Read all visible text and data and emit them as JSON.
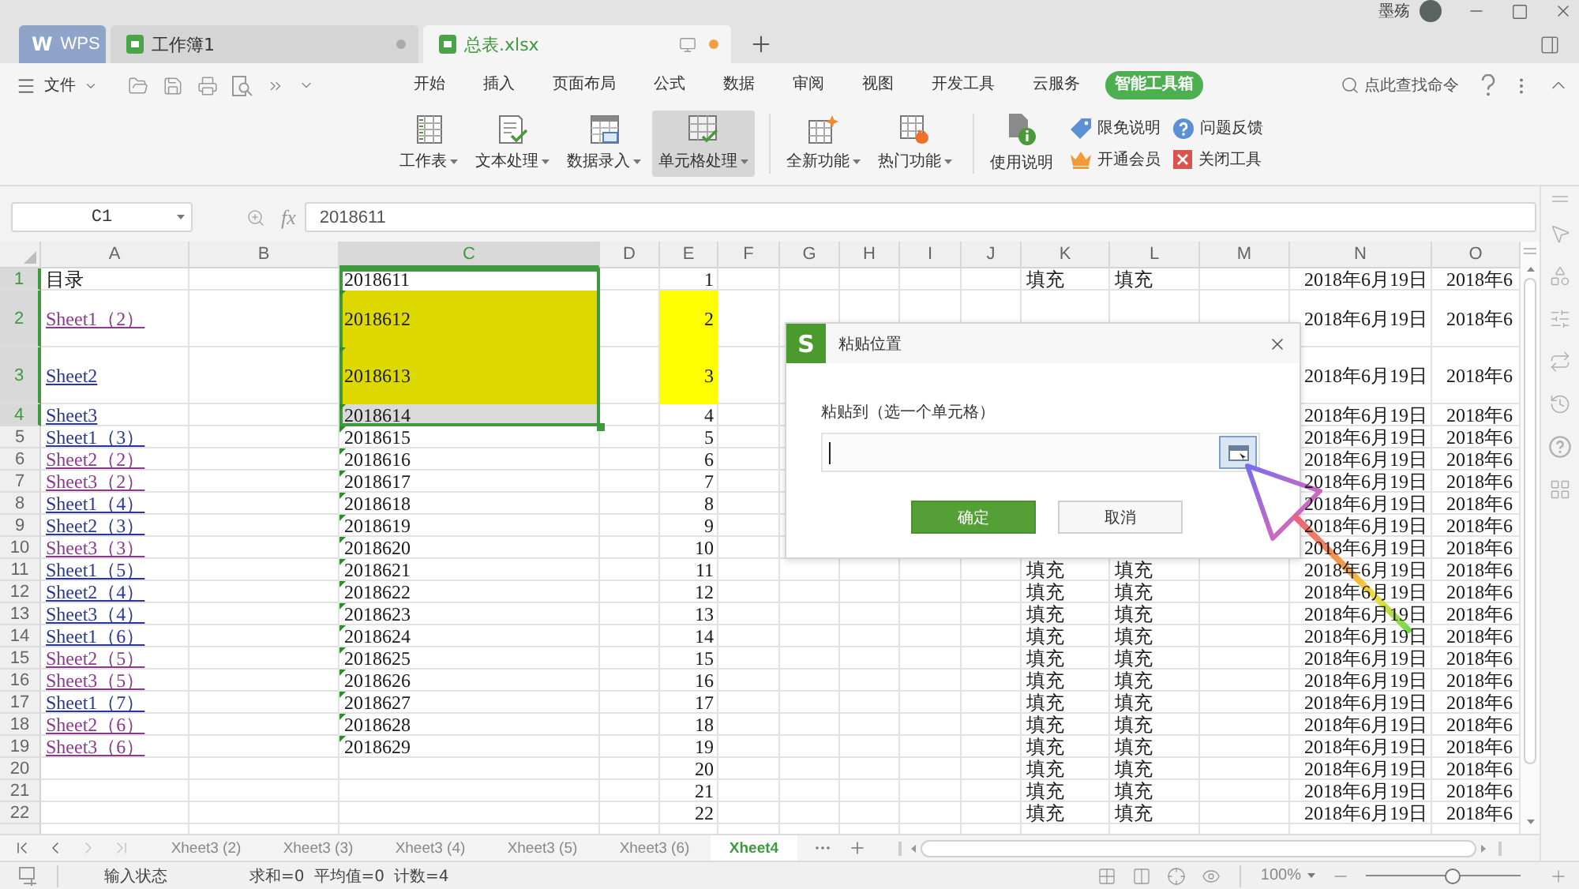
{
  "window": {
    "user_name": "墨殇"
  },
  "app_tabs": [
    {
      "kind": "home",
      "logo": "W",
      "label": "WPS",
      "selected": false
    },
    {
      "kind": "document",
      "label": "工作簿1",
      "selected": false,
      "modified": false
    },
    {
      "kind": "document",
      "label": "总表.xlsx",
      "selected": true,
      "modified": true
    }
  ],
  "menu": {
    "file_label": "文件"
  },
  "ribbon_tabs": [
    {
      "label": "开始",
      "selected": false
    },
    {
      "label": "插入",
      "selected": false
    },
    {
      "label": "页面布局",
      "selected": false
    },
    {
      "label": "公式",
      "selected": false
    },
    {
      "label": "数据",
      "selected": false
    },
    {
      "label": "审阅",
      "selected": false
    },
    {
      "label": "视图",
      "selected": false
    },
    {
      "label": "开发工具",
      "selected": false
    },
    {
      "label": "云服务",
      "selected": false
    },
    {
      "label": "智能工具箱",
      "selected": true
    }
  ],
  "command_search": {
    "placeholder": "点此查找命令"
  },
  "toolbar": [
    {
      "buttons": [
        {
          "label": "工作表",
          "dropdown": true,
          "selected": false
        },
        {
          "label": "文本处理",
          "dropdown": true,
          "selected": false
        },
        {
          "label": "数据录入",
          "dropdown": true,
          "selected": false
        },
        {
          "label": "单元格处理",
          "dropdown": true,
          "selected": true
        }
      ]
    },
    {
      "buttons": [
        {
          "label": "全新功能",
          "dropdown": true,
          "selected": false
        },
        {
          "label": "热门功能",
          "dropdown": true,
          "selected": false
        }
      ]
    },
    {
      "buttons": [
        {
          "label": "使用说明",
          "dropdown": false,
          "selected": false
        }
      ],
      "links": [
        {
          "label": "限免说明"
        },
        {
          "label": "问题反馈"
        },
        {
          "label": "开通会员"
        },
        {
          "label": "关闭工具"
        }
      ]
    }
  ],
  "formula_bar": {
    "cell_name": "C1",
    "function_label": "fx",
    "value": "2018611"
  },
  "sheet": {
    "columns": [
      {
        "label": "A",
        "selected": false
      },
      {
        "label": "B",
        "selected": false
      },
      {
        "label": "C",
        "selected": true
      },
      {
        "label": "D",
        "selected": false
      },
      {
        "label": "E",
        "selected": false
      },
      {
        "label": "F",
        "selected": false
      },
      {
        "label": "G",
        "selected": false
      },
      {
        "label": "H",
        "selected": false
      },
      {
        "label": "I",
        "selected": false
      },
      {
        "label": "J",
        "selected": false
      },
      {
        "label": "K",
        "selected": false
      },
      {
        "label": "L",
        "selected": false
      },
      {
        "label": "M",
        "selected": false
      },
      {
        "label": "N",
        "selected": false
      },
      {
        "label": "O",
        "selected": false
      }
    ],
    "rows": [
      {
        "number": "1",
        "selected": true,
        "tall": false,
        "cells": {
          "a": {
            "kind": "text",
            "text": "目录"
          },
          "c": {
            "text": "2018611",
            "flag": false,
            "highlighted": false
          },
          "e": {
            "text": "1",
            "highlighted": false
          },
          "k": {
            "text": "填充"
          },
          "l": {
            "text": "填充"
          },
          "n": {
            "text": "2018年6月19日"
          },
          "o": {
            "text": "2018年6"
          }
        }
      },
      {
        "number": "2",
        "selected": true,
        "tall": true,
        "cells": {
          "a": {
            "kind": "link",
            "text": "Sheet1（2）",
            "visited": true
          },
          "c": {
            "text": "2018612",
            "flag": true,
            "highlighted": true
          },
          "e": {
            "text": "2",
            "highlighted": true
          },
          "n": {
            "text": "2018年6月19日"
          },
          "o": {
            "text": "2018年6"
          }
        }
      },
      {
        "number": "3",
        "selected": true,
        "tall": true,
        "cells": {
          "a": {
            "kind": "link",
            "text": "Sheet2",
            "visited": false
          },
          "c": {
            "text": "2018613",
            "flag": true,
            "highlighted": true
          },
          "e": {
            "text": "3",
            "highlighted": true
          },
          "n": {
            "text": "2018年6月19日"
          },
          "o": {
            "text": "2018年6"
          }
        }
      },
      {
        "number": "4",
        "selected": true,
        "tall": false,
        "cells": {
          "a": {
            "kind": "link",
            "text": "Sheet3",
            "visited": false
          },
          "c": {
            "text": "2018614",
            "flag": true,
            "highlighted": false
          },
          "e": {
            "text": "4",
            "highlighted": false
          },
          "n": {
            "text": "2018年6月19日"
          },
          "o": {
            "text": "2018年6"
          }
        }
      },
      {
        "number": "5",
        "selected": false,
        "tall": false,
        "cells": {
          "a": {
            "kind": "link",
            "text": "Sheet1（3）",
            "visited": false
          },
          "c": {
            "text": "2018615",
            "flag": true,
            "highlighted": false
          },
          "e": {
            "text": "5",
            "highlighted": false
          },
          "n": {
            "text": "2018年6月19日"
          },
          "o": {
            "text": "2018年6"
          }
        }
      },
      {
        "number": "6",
        "selected": false,
        "tall": false,
        "cells": {
          "a": {
            "kind": "link",
            "text": "Sheet2（2）",
            "visited": true
          },
          "c": {
            "text": "2018616",
            "flag": true,
            "highlighted": false
          },
          "e": {
            "text": "6",
            "highlighted": false
          },
          "n": {
            "text": "2018年6月19日"
          },
          "o": {
            "text": "2018年6"
          }
        }
      },
      {
        "number": "7",
        "selected": false,
        "tall": false,
        "cells": {
          "a": {
            "kind": "link",
            "text": "Sheet3（2）",
            "visited": true
          },
          "c": {
            "text": "2018617",
            "flag": true,
            "highlighted": false
          },
          "e": {
            "text": "7",
            "highlighted": false
          },
          "n": {
            "text": "2018年6月19日"
          },
          "o": {
            "text": "2018年6"
          }
        }
      },
      {
        "number": "8",
        "selected": false,
        "tall": false,
        "cells": {
          "a": {
            "kind": "link",
            "text": "Sheet1（4）",
            "visited": false
          },
          "c": {
            "text": "2018618",
            "flag": true,
            "highlighted": false
          },
          "e": {
            "text": "8",
            "highlighted": false
          },
          "n": {
            "text": "2018年6月19日"
          },
          "o": {
            "text": "2018年6"
          }
        }
      },
      {
        "number": "9",
        "selected": false,
        "tall": false,
        "cells": {
          "a": {
            "kind": "link",
            "text": "Sheet2（3）",
            "visited": false
          },
          "c": {
            "text": "2018619",
            "flag": true,
            "highlighted": false
          },
          "e": {
            "text": "9",
            "highlighted": false
          },
          "n": {
            "text": "2018年6月19日"
          },
          "o": {
            "text": "2018年6"
          }
        }
      },
      {
        "number": "10",
        "selected": false,
        "tall": false,
        "cells": {
          "a": {
            "kind": "link",
            "text": "Sheet3（3）",
            "visited": true
          },
          "c": {
            "text": "2018620",
            "flag": true,
            "highlighted": false
          },
          "e": {
            "text": "10",
            "highlighted": false
          },
          "n": {
            "text": "2018年6月19日"
          },
          "o": {
            "text": "2018年6"
          }
        }
      },
      {
        "number": "11",
        "selected": false,
        "tall": false,
        "cells": {
          "a": {
            "kind": "link",
            "text": "Sheet1（5）",
            "visited": false
          },
          "c": {
            "text": "2018621",
            "flag": true,
            "highlighted": false
          },
          "e": {
            "text": "11",
            "highlighted": false
          },
          "k": {
            "text": "填充"
          },
          "l": {
            "text": "填充"
          },
          "n": {
            "text": "2018年6月19日"
          },
          "o": {
            "text": "2018年6"
          }
        }
      },
      {
        "number": "12",
        "selected": false,
        "tall": false,
        "cells": {
          "a": {
            "kind": "link",
            "text": "Sheet2（4）",
            "visited": false
          },
          "c": {
            "text": "2018622",
            "flag": true,
            "highlighted": false
          },
          "e": {
            "text": "12",
            "highlighted": false
          },
          "k": {
            "text": "填充"
          },
          "l": {
            "text": "填充"
          },
          "n": {
            "text": "2018年6月19日"
          },
          "o": {
            "text": "2018年6"
          }
        }
      },
      {
        "number": "13",
        "selected": false,
        "tall": false,
        "cells": {
          "a": {
            "kind": "link",
            "text": "Sheet3（4）",
            "visited": false
          },
          "c": {
            "text": "2018623",
            "flag": true,
            "highlighted": false
          },
          "e": {
            "text": "13",
            "highlighted": false
          },
          "k": {
            "text": "填充"
          },
          "l": {
            "text": "填充"
          },
          "n": {
            "text": "2018年6月19日"
          },
          "o": {
            "text": "2018年6"
          }
        }
      },
      {
        "number": "14",
        "selected": false,
        "tall": false,
        "cells": {
          "a": {
            "kind": "link",
            "text": "Sheet1（6）",
            "visited": false
          },
          "c": {
            "text": "2018624",
            "flag": true,
            "highlighted": false
          },
          "e": {
            "text": "14",
            "highlighted": false
          },
          "k": {
            "text": "填充"
          },
          "l": {
            "text": "填充"
          },
          "n": {
            "text": "2018年6月19日"
          },
          "o": {
            "text": "2018年6"
          }
        }
      },
      {
        "number": "15",
        "selected": false,
        "tall": false,
        "cells": {
          "a": {
            "kind": "link",
            "text": "Sheet2（5）",
            "visited": true
          },
          "c": {
            "text": "2018625",
            "flag": true,
            "highlighted": false
          },
          "e": {
            "text": "15",
            "highlighted": false
          },
          "k": {
            "text": "填充"
          },
          "l": {
            "text": "填充"
          },
          "n": {
            "text": "2018年6月19日"
          },
          "o": {
            "text": "2018年6"
          }
        }
      },
      {
        "number": "16",
        "selected": false,
        "tall": false,
        "cells": {
          "a": {
            "kind": "link",
            "text": "Sheet3（5）",
            "visited": true
          },
          "c": {
            "text": "2018626",
            "flag": true,
            "highlighted": false
          },
          "e": {
            "text": "16",
            "highlighted": false
          },
          "k": {
            "text": "填充"
          },
          "l": {
            "text": "填充"
          },
          "n": {
            "text": "2018年6月19日"
          },
          "o": {
            "text": "2018年6"
          }
        }
      },
      {
        "number": "17",
        "selected": false,
        "tall": false,
        "cells": {
          "a": {
            "kind": "link",
            "text": "Sheet1（7）",
            "visited": false
          },
          "c": {
            "text": "2018627",
            "flag": true,
            "highlighted": false
          },
          "e": {
            "text": "17",
            "highlighted": false
          },
          "k": {
            "text": "填充"
          },
          "l": {
            "text": "填充"
          },
          "n": {
            "text": "2018年6月19日"
          },
          "o": {
            "text": "2018年6"
          }
        }
      },
      {
        "number": "18",
        "selected": false,
        "tall": false,
        "cells": {
          "a": {
            "kind": "link",
            "text": "Sheet2（6）",
            "visited": true
          },
          "c": {
            "text": "2018628",
            "flag": true,
            "highlighted": false
          },
          "e": {
            "text": "18",
            "highlighted": false
          },
          "k": {
            "text": "填充"
          },
          "l": {
            "text": "填充"
          },
          "n": {
            "text": "2018年6月19日"
          },
          "o": {
            "text": "2018年6"
          }
        }
      },
      {
        "number": "19",
        "selected": false,
        "tall": false,
        "cells": {
          "a": {
            "kind": "link",
            "text": "Sheet3（6）",
            "visited": true
          },
          "c": {
            "text": "2018629",
            "flag": true,
            "highlighted": false
          },
          "e": {
            "text": "19",
            "highlighted": false
          },
          "k": {
            "text": "填充"
          },
          "l": {
            "text": "填充"
          },
          "n": {
            "text": "2018年6月19日"
          },
          "o": {
            "text": "2018年6"
          }
        }
      },
      {
        "number": "20",
        "selected": false,
        "tall": false,
        "cells": {
          "e": {
            "text": "20",
            "highlighted": false
          },
          "k": {
            "text": "填充"
          },
          "l": {
            "text": "填充"
          },
          "n": {
            "text": "2018年6月19日"
          },
          "o": {
            "text": "2018年6"
          }
        }
      },
      {
        "number": "21",
        "selected": false,
        "tall": false,
        "cells": {
          "e": {
            "text": "21",
            "highlighted": false
          },
          "k": {
            "text": "填充"
          },
          "l": {
            "text": "填充"
          },
          "n": {
            "text": "2018年6月19日"
          },
          "o": {
            "text": "2018年6"
          }
        }
      },
      {
        "number": "22",
        "selected": false,
        "tall": false,
        "cells": {
          "e": {
            "text": "22",
            "highlighted": false
          },
          "k": {
            "text": "填充"
          },
          "l": {
            "text": "填充"
          },
          "n": {
            "text": "2018年6月19日"
          },
          "o": {
            "text": "2018年6"
          }
        }
      }
    ]
  },
  "sheet_navigation": [
    {
      "kind": "first",
      "disabled": false
    },
    {
      "kind": "previous",
      "disabled": false
    },
    {
      "kind": "next",
      "disabled": true
    },
    {
      "kind": "last",
      "disabled": true
    }
  ],
  "sheet_tabs": [
    {
      "label": "Xheet3 (2)",
      "selected": false
    },
    {
      "label": "Xheet3 (3)",
      "selected": false
    },
    {
      "label": "Xheet3 (4)",
      "selected": false
    },
    {
      "label": "Xheet3 (5)",
      "selected": false
    },
    {
      "label": "Xheet3 (6)",
      "selected": false
    },
    {
      "label": "Xheet4",
      "selected": true
    }
  ],
  "status_bar": {
    "mode": "输入状态",
    "sum": "求和=0",
    "average": "平均值=0",
    "count": "计数=4",
    "zoom": "100%",
    "zoom_slider": {
      "level": 0.56
    }
  },
  "dialog": {
    "logo": "S",
    "title": "粘贴位置",
    "field_label": "粘贴到（选一个单元格）",
    "target_field": {
      "focused": true
    },
    "buttons": [
      {
        "label": "确定",
        "kind": "primary"
      },
      {
        "label": "取消",
        "kind": "secondary"
      }
    ]
  }
}
